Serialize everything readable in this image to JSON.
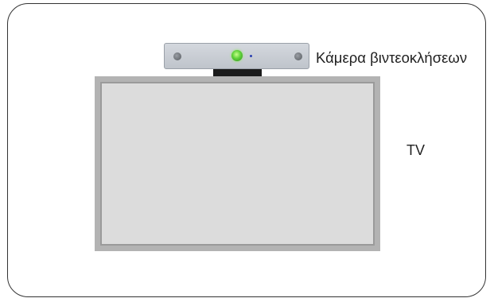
{
  "labels": {
    "camera": "Κάμερα βιντεοκλήσεων",
    "tv": "TV"
  },
  "colors": {
    "frame_border": "#333333",
    "camera_body": "#c8ccd2",
    "camera_lens": "#5fd13a",
    "camera_led": "#2a3fb0",
    "mount": "#1b1b1b",
    "tv_bezel": "#b3b3b3",
    "tv_screen": "#dcdcdc"
  },
  "icons": {
    "camera": "video-camera-icon",
    "tv": "tv-screen-icon"
  }
}
